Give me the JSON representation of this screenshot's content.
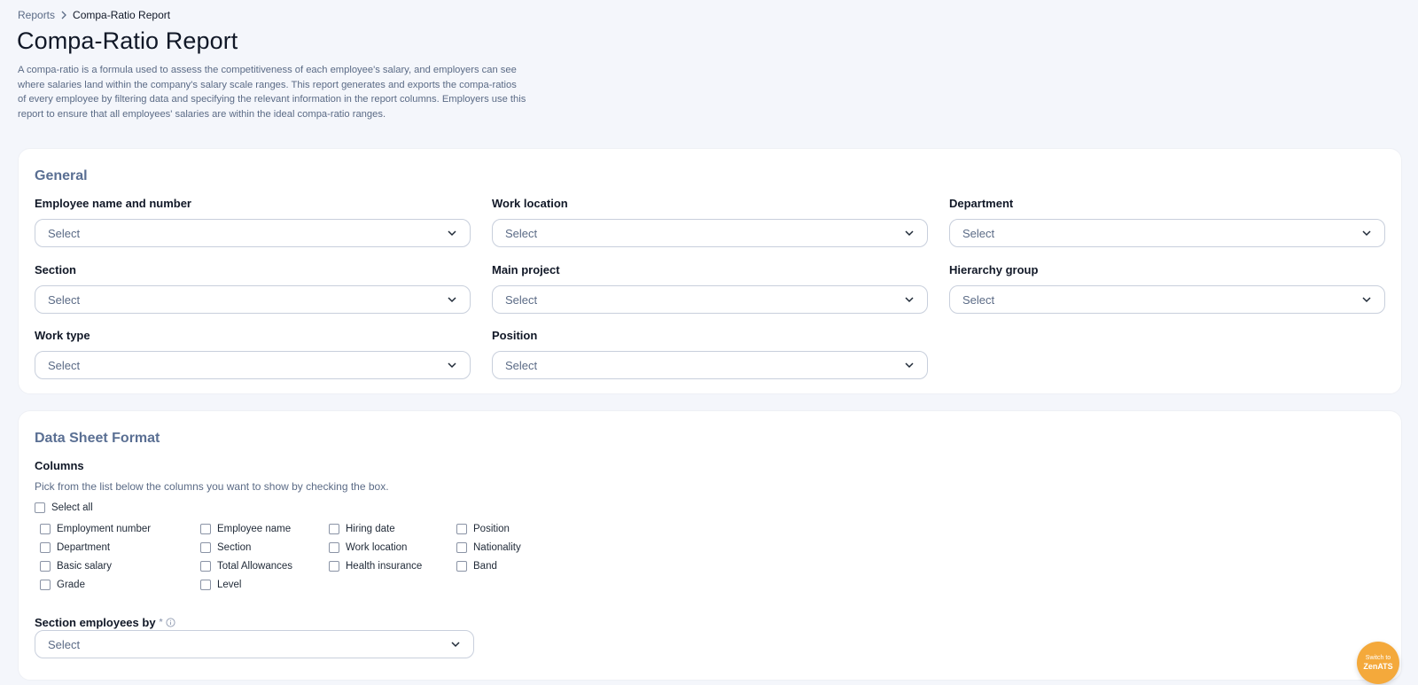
{
  "breadcrumb": {
    "parent": "Reports",
    "current": "Compa-Ratio Report"
  },
  "page": {
    "title": "Compa-Ratio Report",
    "description": "A compa-ratio is a formula used to assess the competitiveness of each employee's salary, and employers can see where salaries land within the company's salary scale ranges. This report generates and exports the compa-ratios of every employee by filtering data and specifying the relevant information in the report columns. Employers use this report to ensure that all employees' salaries are within the ideal compa-ratio ranges."
  },
  "general": {
    "title": "General",
    "fields": [
      {
        "label": "Employee name and number",
        "value": "Select"
      },
      {
        "label": "Work location",
        "value": "Select"
      },
      {
        "label": "Department",
        "value": "Select"
      },
      {
        "label": "Section",
        "value": "Select"
      },
      {
        "label": "Main project",
        "value": "Select"
      },
      {
        "label": "Hierarchy group",
        "value": "Select"
      },
      {
        "label": "Work type",
        "value": "Select"
      },
      {
        "label": "Position",
        "value": "Select"
      }
    ]
  },
  "format": {
    "title": "Data Sheet Format",
    "columns_label": "Columns",
    "columns_help": "Pick from the list below the columns you want to show by checking the box.",
    "select_all": "Select all",
    "columns": [
      "Employment number",
      "Employee name",
      "Hiring date",
      "Position",
      "Department",
      "Section",
      "Work location",
      "Nationality",
      "Basic salary",
      "Total Allowances",
      "Health insurance",
      "Band",
      "Grade",
      "Level"
    ],
    "section_by_label": "Section employees by",
    "section_by_required": "*",
    "section_by_value": "Select"
  },
  "switch_button": {
    "line1": "Switch to",
    "line2": "ZenATS"
  },
  "colors": {
    "accent": "#5a6f93",
    "switch": "#f4a93b",
    "background": "#f4f6fb"
  }
}
